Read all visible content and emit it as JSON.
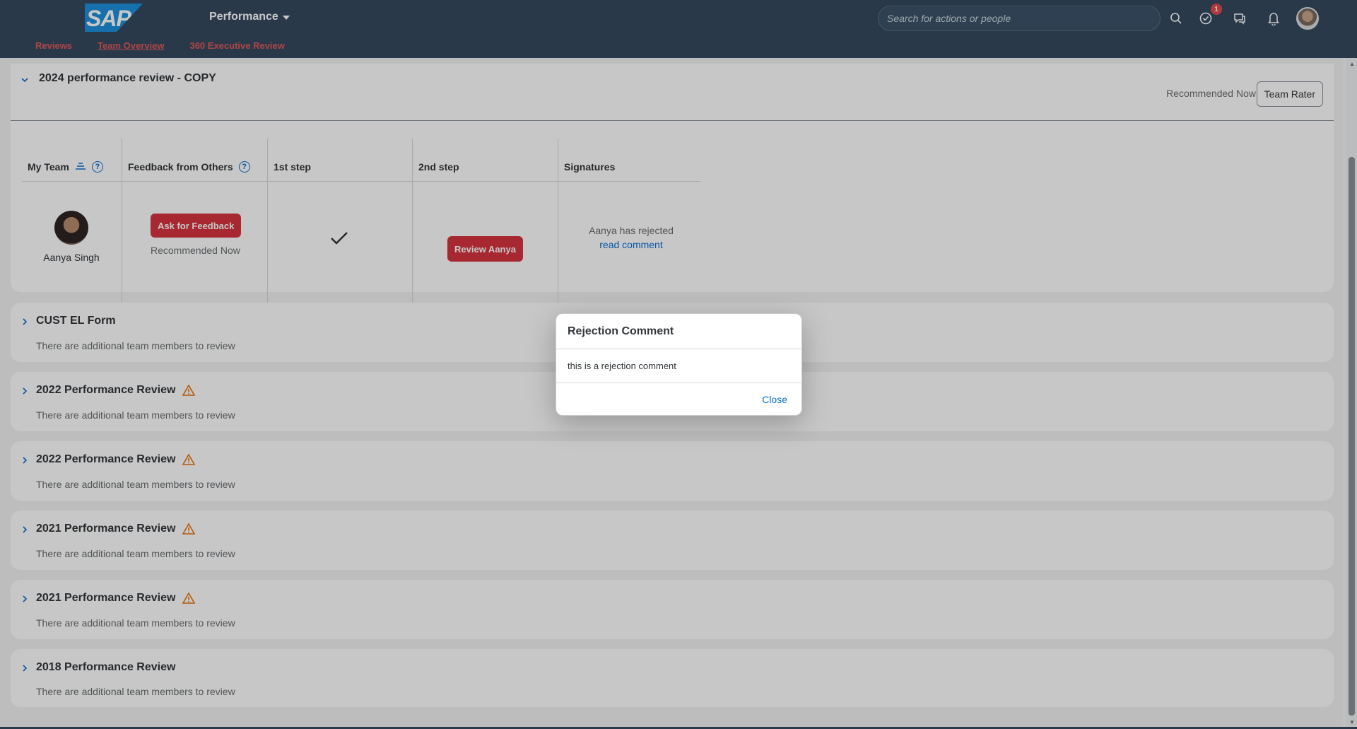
{
  "shell": {
    "logo_text": "SAP",
    "app_title": "Performance",
    "search_placeholder": "Search for actions or people",
    "notification_badge": "1"
  },
  "subnav": {
    "items": [
      "Reviews",
      "Team Overview",
      "360 Executive Review"
    ],
    "active": "Team Overview"
  },
  "main_card": {
    "title": "2024 performance review - COPY",
    "recommended_label": "Recommended Now",
    "team_rater_label": "Team Rater",
    "columns": {
      "my_team": "My Team",
      "feedback": "Feedback from Others",
      "step1": "1st step",
      "step2": "2nd step",
      "signatures": "Signatures"
    },
    "row": {
      "name": "Aanya Singh",
      "ask_feedback_label": "Ask for Feedback",
      "feedback_status": "Recommended Now",
      "review_button_label": "Review Aanya",
      "signature_status": "Aanya has rejected",
      "read_comment_label": "read comment"
    }
  },
  "sections": [
    {
      "title": "CUST EL Form",
      "subtitle": "There are additional team members to review",
      "warning": false
    },
    {
      "title": "2022 Performance Review",
      "subtitle": "There are additional team members to review",
      "warning": true
    },
    {
      "title": "2022 Performance Review",
      "subtitle": "There are additional team members to review",
      "warning": true
    },
    {
      "title": "2021 Performance Review",
      "subtitle": "There are additional team members to review",
      "warning": true
    },
    {
      "title": "2021 Performance Review",
      "subtitle": "There are additional team members to review",
      "warning": true
    },
    {
      "title": "2018 Performance Review",
      "subtitle": "There are additional team members to review",
      "warning": false
    }
  ],
  "dialog": {
    "title": "Rejection Comment",
    "body": "this is a rejection comment",
    "close_label": "Close"
  },
  "colors": {
    "shell": "#354a5f",
    "accent_red": "#d6343f",
    "link_blue": "#0a6ed1",
    "warning": "#e9730c"
  },
  "icons": [
    "search-icon",
    "task-check-icon",
    "chat-icon",
    "bell-icon",
    "user-avatar",
    "sort-icon",
    "help-icon",
    "checkmark-icon",
    "chevron-down-icon",
    "chevron-right-icon",
    "warning-icon"
  ]
}
